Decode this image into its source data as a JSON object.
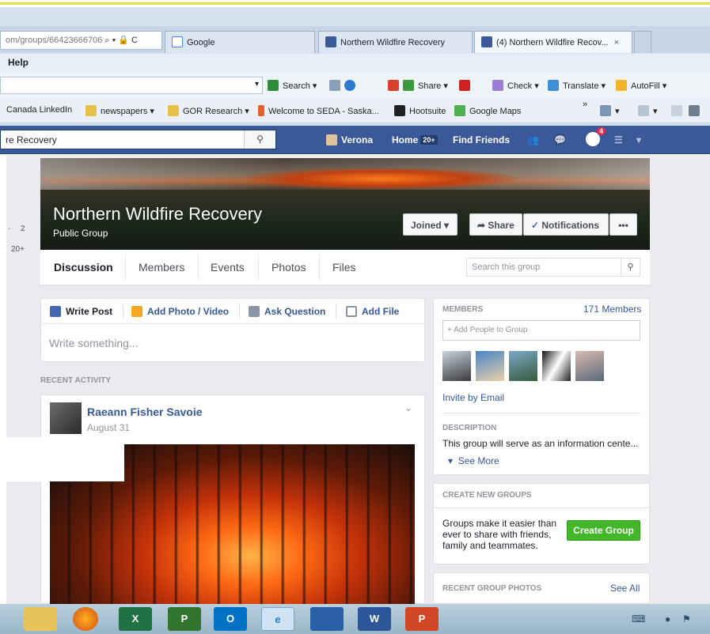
{
  "browser": {
    "address": "om/groups/66423666706",
    "address_suffix": "⌕ ▾ 🔒 C",
    "tabs": [
      {
        "label": "Google"
      },
      {
        "label": "Northern Wildfire Recovery"
      },
      {
        "label": "(4) Northern Wildfire Recov..."
      }
    ],
    "tab_close": "×",
    "menu": {
      "help": "Help"
    },
    "commands": {
      "search": "Search ▾",
      "share": "Share ▾",
      "check": "Check ▾",
      "translate": "Translate ▾",
      "autofill": "AutoFill ▾"
    },
    "favorites": [
      "Canada LinkedIn",
      "newspapers ▾",
      "GOR Research ▾",
      "Welcome to SEDA - Saska...",
      "Hootsuite",
      "Google Maps"
    ],
    "more": "»"
  },
  "fb": {
    "search_value": "re Recovery",
    "user": "Verona",
    "home": "Home",
    "home_badge": "20+",
    "find_friends": "Find Friends",
    "notif_count": "4"
  },
  "left_rail": {
    "count1": "2",
    "count2": "20+",
    "dot": "."
  },
  "group": {
    "name": "Northern Wildfire Recovery",
    "type": "Public Group",
    "joined": "Joined ▾",
    "share": "Share",
    "notifications": "Notifications",
    "more": "•••",
    "tabs": [
      "Discussion",
      "Members",
      "Events",
      "Photos",
      "Files"
    ],
    "search_placeholder": "Search this group"
  },
  "composer": {
    "actions": [
      "Write Post",
      "Add Photo / Video",
      "Ask Question",
      "Add File"
    ],
    "placeholder": "Write something..."
  },
  "feed": {
    "section": "RECENT ACTIVITY",
    "post": {
      "author": "Raeann Fisher Savoie",
      "date": "August 31"
    }
  },
  "sidebar": {
    "members_title": "MEMBERS",
    "members_count": "171 Members",
    "add_people": "+ Add People to Group",
    "invite": "Invite by Email",
    "description_title": "DESCRIPTION",
    "description": "This group will serve as an information cente...",
    "see_more": "See More",
    "create_title": "CREATE NEW GROUPS",
    "create_text": "Groups make it easier than ever to share with friends, family and teammates.",
    "create_button": "Create Group",
    "recent_photos_title": "RECENT GROUP PHOTOS",
    "see_all": "See All"
  },
  "colors": {
    "fb_blue": "#3b5998",
    "link": "#365899",
    "green": "#42b72a"
  }
}
